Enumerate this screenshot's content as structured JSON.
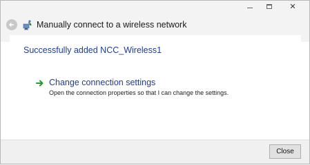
{
  "window": {
    "title": "Manually connect to a wireless network",
    "caption": {
      "close_glyph": "✕"
    }
  },
  "content": {
    "success_message": "Successfully added NCC_Wireless1",
    "option": {
      "title": "Change connection settings",
      "description": "Open the connection properties so that I can change the settings."
    }
  },
  "footer": {
    "close_label": "Close"
  },
  "colors": {
    "link_blue": "#1e3d8f",
    "arrow_green": "#1a9e2c"
  },
  "icons": {
    "back": "back-arrow-icon",
    "network": "wireless-network-icon",
    "option_arrow": "green-arrow-icon"
  }
}
